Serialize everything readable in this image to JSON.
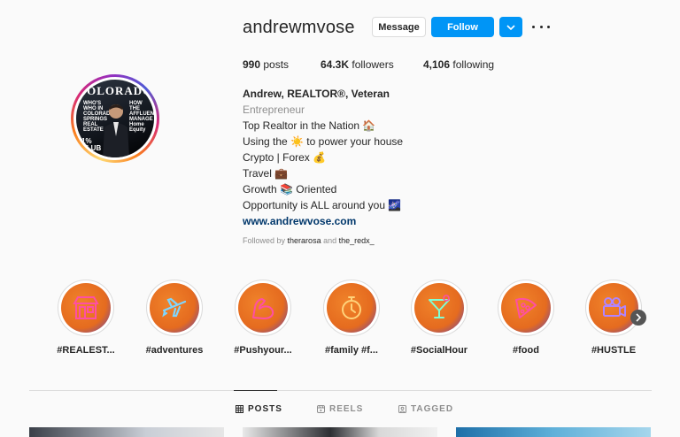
{
  "profile": {
    "username": "andrewmvose",
    "message_label": "Message",
    "follow_label": "Follow",
    "avatar_magazine_title": "COLORADO",
    "avatar_text_left": "WHO'S WHO IN COLORADO SPRINGS REAL ESTATE",
    "avatar_text_right": "HOW THE AFFLUENT MANAGE Home Equity",
    "avatar_text_club": "1% CLUB"
  },
  "stats": {
    "posts_count": "990",
    "posts_label": "posts",
    "followers_count": "64.3K",
    "followers_label": "followers",
    "following_count": "4,106",
    "following_label": "following"
  },
  "bio": {
    "name": "Andrew, REALTOR®, Veteran",
    "category": "Entrepreneur",
    "lines": [
      "Top Realtor in the Nation 🏠",
      "Using the ☀️ to power your house",
      "Crypto | Forex 💰",
      "Travel 💼",
      "Growth 📚 Oriented",
      "Opportunity is ALL around you 🌌"
    ],
    "link": "www.andrewvose.com",
    "followed_prefix": "Followed by",
    "followed_user1": "therarosa",
    "followed_and": "and",
    "followed_user2": "the_redx_"
  },
  "highlights": [
    {
      "label": "#REALEST...",
      "icon": "storefront-icon"
    },
    {
      "label": "#adventures",
      "icon": "airplane-icon"
    },
    {
      "label": "#Pushyour...",
      "icon": "flexed-arm-icon"
    },
    {
      "label": "#family #f...",
      "icon": "stopwatch-icon"
    },
    {
      "label": "#SocialHour",
      "icon": "cocktail-icon"
    },
    {
      "label": "#food",
      "icon": "pizza-icon"
    },
    {
      "label": "#HUSTLE",
      "icon": "video-camera-icon"
    }
  ],
  "tabs": [
    {
      "label": "POSTS",
      "icon": "grid-icon",
      "active": true
    },
    {
      "label": "REELS",
      "icon": "reels-icon",
      "active": false
    },
    {
      "label": "TAGGED",
      "icon": "tagged-icon",
      "active": false
    }
  ],
  "colors": {
    "follow_blue": "#0095f6",
    "link_blue": "#00376b",
    "highlight_orange": "#e56b1f",
    "neon_pink": "#ff4fa3"
  }
}
